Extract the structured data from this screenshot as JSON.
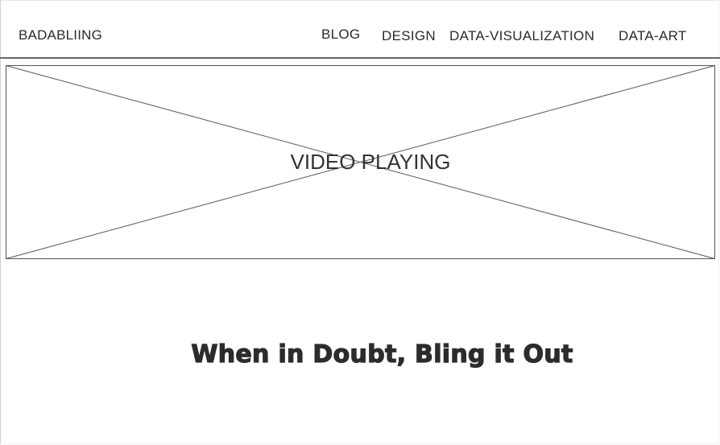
{
  "header": {
    "brand": "BADABLIING",
    "nav": {
      "blog": "BLOG",
      "design": "DESIGN",
      "data_visualization": "DATA-VISUALIZATION",
      "data_art": "DATA-ART"
    }
  },
  "hero": {
    "video_label": "VIDEO PLAYING"
  },
  "main": {
    "tagline": "When in Doubt, Bling it Out"
  }
}
